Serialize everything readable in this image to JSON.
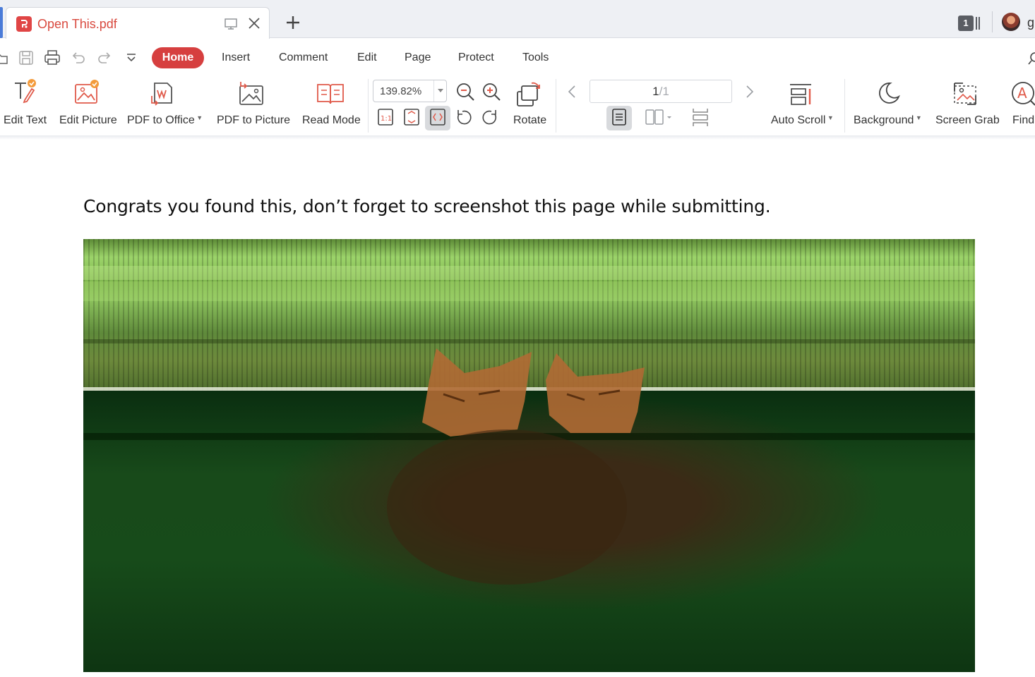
{
  "tabs": [
    {
      "title": "Open This.pdf",
      "active": true
    }
  ],
  "tab_count": "1",
  "user_initial": "g",
  "menu": {
    "items": [
      "Home",
      "Insert",
      "Comment",
      "Edit",
      "Page",
      "Protect",
      "Tools"
    ],
    "active": "Home"
  },
  "ribbon": {
    "edit_text": "Edit Text",
    "edit_picture": "Edit Picture",
    "pdf_to_office": "PDF to Office",
    "pdf_to_picture": "PDF to Picture",
    "read_mode": "Read Mode",
    "zoom": "139.82%",
    "rotate": "Rotate",
    "page_current": "1",
    "page_total": "/1",
    "auto_scroll": "Auto Scroll",
    "background": "Background",
    "screen_grab": "Screen Grab",
    "find": "Find"
  },
  "document": {
    "text": "Congrats you found this, don’t forget to screenshot this page while submitting."
  },
  "colors": {
    "accent": "#d63f3f",
    "tab_title": "#d94a3f",
    "icon_red": "#e05a4a"
  }
}
